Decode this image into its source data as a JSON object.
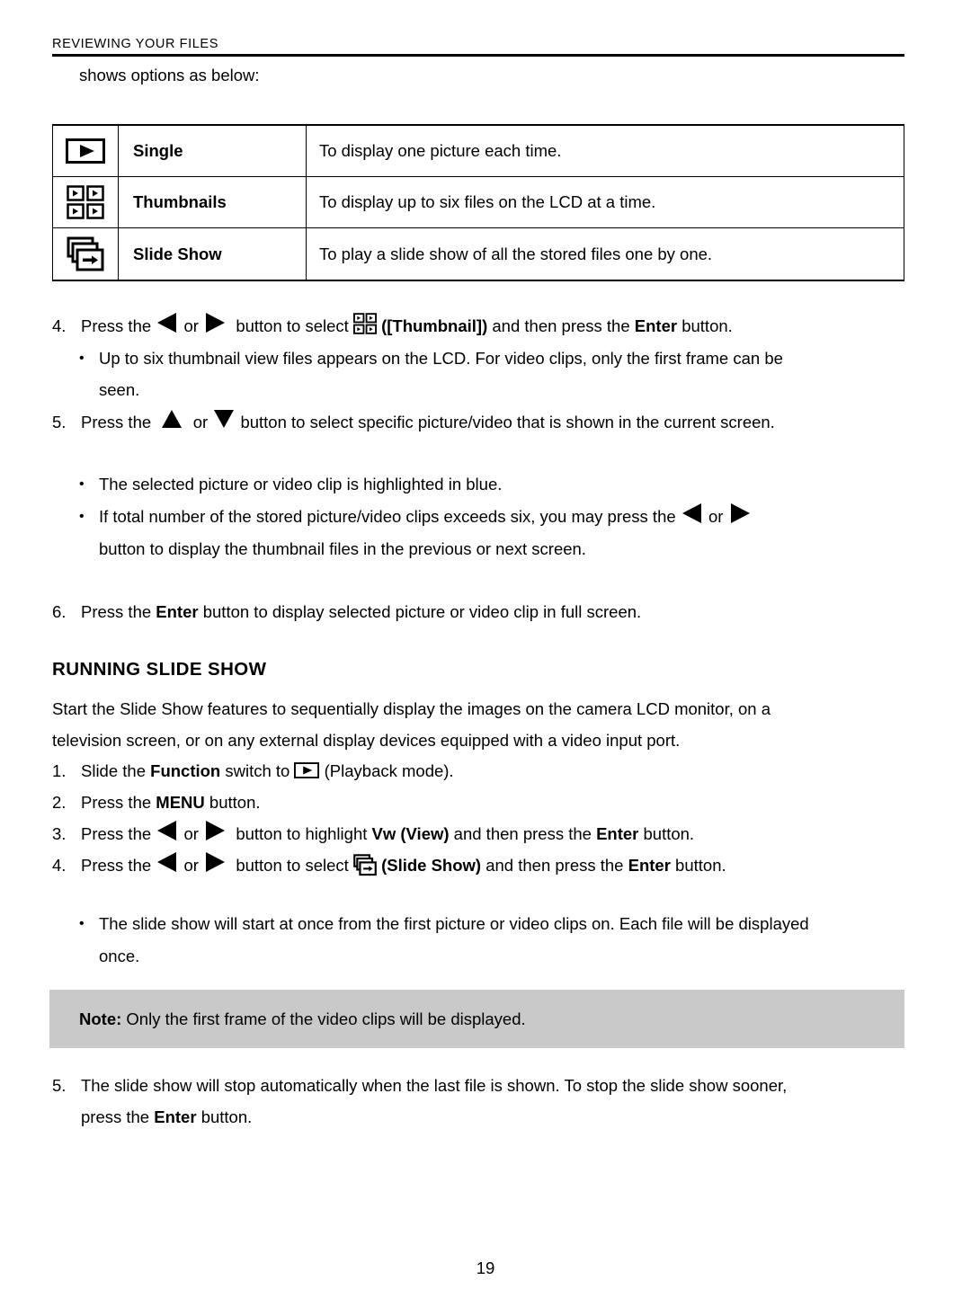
{
  "header": {
    "running_title": "REVIEWING YOUR FILES"
  },
  "intro": {
    "line": "shows options as below:"
  },
  "options_table": {
    "rows": [
      {
        "icon": "single-play-icon",
        "name": "Single",
        "description": "To display one picture each time."
      },
      {
        "icon": "thumbnails-grid-icon",
        "name": "Thumbnails",
        "description": "To display up to six files on the LCD at a time."
      },
      {
        "icon": "slide-show-icon",
        "name": "Slide Show",
        "description": "To play a slide show of all the stored files one by one."
      }
    ]
  },
  "steps_thumbnail": [
    {
      "number": "4.",
      "part1": "Press the",
      "left_icon": "left-triangle-icon",
      "or": "or",
      "right_icon": "right-triangle-icon",
      "part2": "button to select",
      "inline_icon": "thumbnails-grid-icon",
      "part3_bold": "([Thumbnail])",
      "part4": "and then press the",
      "bold_enter": "Enter",
      "part5": "button."
    },
    {
      "number": "5.",
      "part1": "Press the",
      "up_icon": "up-triangle-icon",
      "or": "or",
      "down_icon": "down-triangle-icon",
      "part2": "button to select specific picture/video that is shown in the current screen."
    },
    {
      "number": "6.",
      "part1": "Press the",
      "bold_enter": "Enter",
      "part2": "button to display selected picture or video clip in full screen."
    }
  ],
  "bullets_thumbnail": [
    {
      "dot": "•",
      "line1": "Up to six thumbnail view files appears on the LCD. For video clips, only the first frame can be",
      "line2": "seen."
    },
    {
      "dot": "•",
      "line1": "The selected picture or video clip is highlighted in blue."
    },
    {
      "dot": "•",
      "part1": "If total number of the stored picture/video clips exceeds six, you may press the",
      "left_icon": "left-triangle-icon",
      "or": "or",
      "right_icon": "right-triangle-icon",
      "line2": "button to display the thumbnail files in the previous or next screen."
    }
  ],
  "slide_show_section": {
    "heading": "RUNNING SLIDE SHOW",
    "paragraph_line1": "Start the Slide Show features to sequentially display the images on the camera LCD monitor, on a",
    "paragraph_line2": "television screen, or on any external display devices equipped with a video input port.",
    "steps": [
      {
        "number": "1.",
        "part1": "Slide the",
        "bold1": "Function",
        "part2": "switch to",
        "inline_icon": "single-play-icon",
        "part3": "(Playback mode)."
      },
      {
        "number": "2.",
        "part1": "Press the",
        "bold1": "MENU",
        "part2": "button."
      },
      {
        "number": "3.",
        "part1": "Press the",
        "left_icon": "left-triangle-icon",
        "or": "or",
        "right_icon": "right-triangle-icon",
        "part2": "button to highlight",
        "bold_vw": "Vw (View)",
        "part3": "and then press the",
        "bold_enter": "Enter",
        "part4": "button."
      },
      {
        "number": "4.",
        "part1": "Press the",
        "left_icon": "left-triangle-icon",
        "or": "or",
        "right_icon": "right-triangle-icon",
        "part2": "button to select",
        "inline_icon": "slide-show-icon",
        "bold_slide": "(Slide Show)",
        "part3": "and then press the",
        "bold_enter": "Enter",
        "part4": "button."
      }
    ],
    "bullet": {
      "dot": "•",
      "line1": "The slide show will start at once from the first picture or video clips on. Each file will be displayed",
      "line2": "once."
    },
    "note": {
      "label": "Note:",
      "text": "Only the first frame of the video clips will be displayed.",
      "background_color": "#c9c9c9"
    },
    "final_step": {
      "number": "5.",
      "line1": "The slide show will stop automatically when the last file is shown. To stop the slide show sooner,",
      "line2_part1": "press the",
      "bold_enter": "Enter",
      "line2_part2": "button."
    }
  },
  "footer": {
    "page_number": "19"
  }
}
